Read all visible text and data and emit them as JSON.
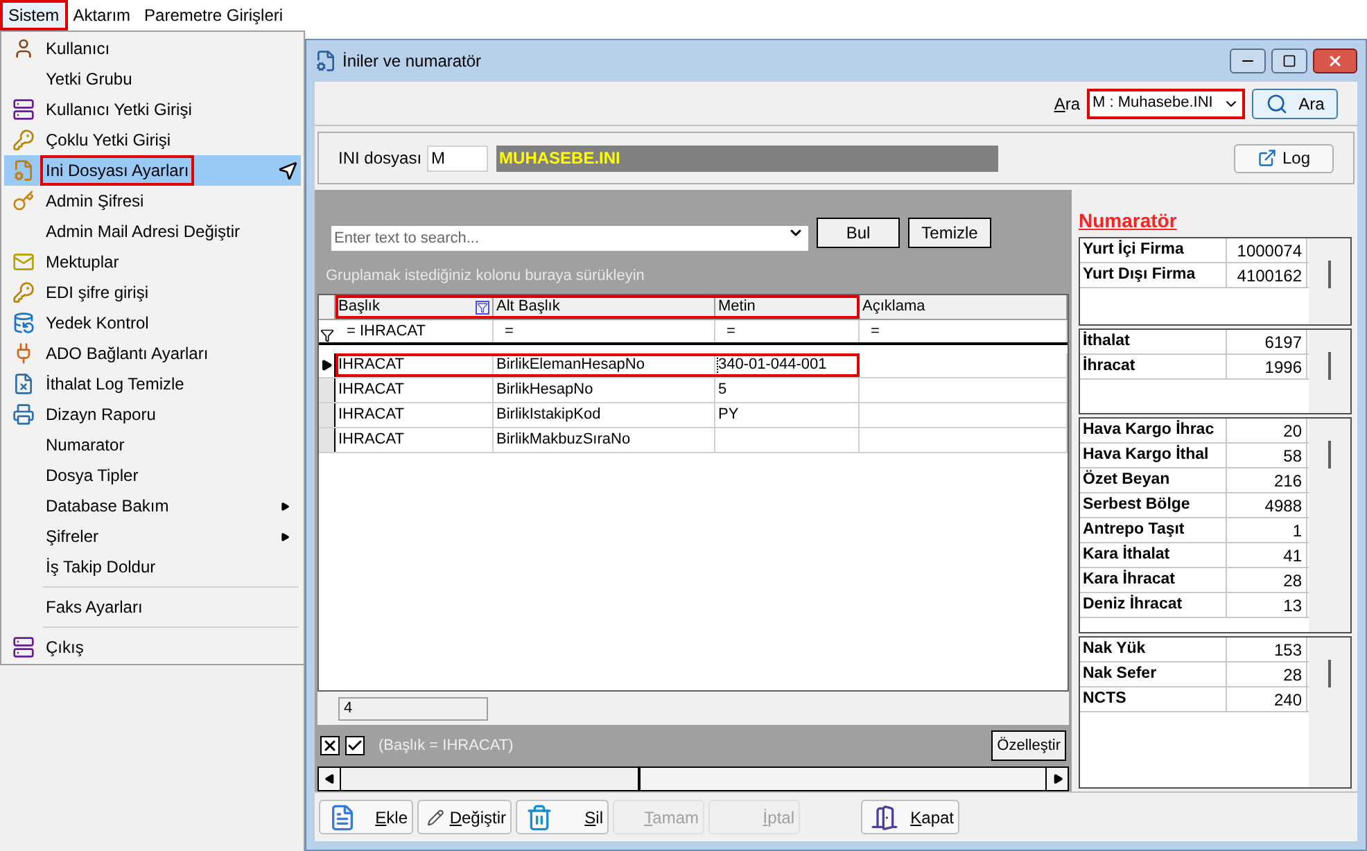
{
  "menubar": [
    {
      "label": "Sistem",
      "selected": true,
      "highlighted": true
    },
    {
      "label": "Aktarım",
      "selected": false,
      "highlighted": false
    },
    {
      "label": "Paremetre Girişleri",
      "selected": false,
      "highlighted": false
    }
  ],
  "menu": [
    {
      "kind": "item",
      "label": "Kullanıcı",
      "selected": false,
      "highlighted": false
    },
    {
      "kind": "item",
      "label": "Yetki Grubu",
      "selected": false,
      "highlighted": false
    },
    {
      "kind": "item",
      "label": "Kullanıcı Yetki Girişi",
      "selected": false,
      "highlighted": false
    },
    {
      "kind": "item",
      "label": "Çoklu Yetki Girişi",
      "selected": false,
      "highlighted": false
    },
    {
      "kind": "item",
      "label": "Ini Dosyası  Ayarları",
      "selected": true,
      "highlighted": true
    },
    {
      "kind": "item",
      "label": "Admin Şifresi",
      "selected": false,
      "highlighted": false
    },
    {
      "kind": "item",
      "label": "Admin Mail Adresi Değiştir",
      "selected": false,
      "highlighted": false
    },
    {
      "kind": "item",
      "label": "Mektuplar",
      "selected": false,
      "highlighted": false
    },
    {
      "kind": "item",
      "label": "EDI şifre girişi",
      "selected": false,
      "highlighted": false
    },
    {
      "kind": "item",
      "label": "Yedek Kontrol",
      "selected": false,
      "highlighted": false
    },
    {
      "kind": "item",
      "label": "ADO Bağlantı Ayarları",
      "selected": false,
      "highlighted": false
    },
    {
      "kind": "item",
      "label": "İthalat Log Temizle",
      "selected": false,
      "highlighted": false
    },
    {
      "kind": "item",
      "label": "Dizayn Raporu",
      "selected": false,
      "highlighted": false
    },
    {
      "kind": "item",
      "label": "Numarator",
      "selected": false,
      "highlighted": false
    },
    {
      "kind": "item",
      "label": "Dosya Tipler",
      "selected": false,
      "highlighted": false
    },
    {
      "kind": "submenu",
      "label": "Database Bakım",
      "selected": false,
      "highlighted": false
    },
    {
      "kind": "submenu",
      "label": "Şifreler",
      "selected": false,
      "highlighted": false
    },
    {
      "kind": "item",
      "label": "İş Takip Doldur",
      "selected": false,
      "highlighted": false
    },
    {
      "kind": "separator"
    },
    {
      "kind": "item",
      "label": "Faks Ayarları",
      "selected": false,
      "highlighted": false
    },
    {
      "kind": "separator"
    },
    {
      "kind": "item",
      "label": "Çıkış",
      "selected": false,
      "highlighted": false
    }
  ],
  "window": {
    "title": "İniler ve numaratör"
  },
  "toolbar": {
    "search_label": "Ara",
    "combo_value": "M : Muhasebe.INI",
    "combo_highlighted": true,
    "search_button": "Ara"
  },
  "ini": {
    "label": "INI dosyası",
    "code": "M",
    "file": "MUHASEBE.INI",
    "log_button": "Log"
  },
  "grid": {
    "search_placeholder": "Enter text to search...",
    "find_button": "Bul",
    "clear_button": "Temizle",
    "group_hint": "Gruplamak istediğiniz kolonu buraya sürükleyin",
    "columns": [
      {
        "label": "Başlık",
        "filtered": true
      },
      {
        "label": "Alt Başlık",
        "filtered": false
      },
      {
        "label": "Metin",
        "filtered": false
      },
      {
        "label": "Açıklama",
        "filtered": false
      }
    ],
    "header_highlighted": true,
    "filter_row": [
      "=  IHRACAT",
      "=",
      "=",
      "="
    ],
    "rows": [
      {
        "cells": [
          "IHRACAT",
          "BirlikElemanHesapNo",
          "340-01-044-001"
        ],
        "selected": true,
        "highlighted": true
      },
      {
        "cells": [
          "IHRACAT",
          "BirlikHesapNo",
          "5"
        ],
        "selected": false,
        "highlighted": false
      },
      {
        "cells": [
          "IHRACAT",
          "BirlikIstakipKod",
          "PY"
        ],
        "selected": false,
        "highlighted": false
      },
      {
        "cells": [
          "IHRACAT",
          "BirlikMakbuzSıraNo"
        ],
        "selected": false,
        "highlighted": false
      }
    ],
    "footer_count": "4",
    "filter": {
      "active": true,
      "text": "(Başlık = IHRACAT)"
    },
    "customize_button": "Özelleştir"
  },
  "numerator": {
    "title": "Numaratör",
    "groups": [
      {
        "rows": [
          {
            "label": "Yurt İçi Firma",
            "value": "1000074"
          },
          {
            "label": "Yurt Dışı Firma",
            "value": "4100162"
          }
        ]
      },
      {
        "rows": [
          {
            "label": "İthalat",
            "value": "6197"
          },
          {
            "label": "İhracat",
            "value": "1996"
          }
        ]
      },
      {
        "rows": [
          {
            "label": "Hava Kargo İhrac",
            "value": "20"
          },
          {
            "label": "Hava Kargo İthal",
            "value": "58"
          },
          {
            "label": "Özet Beyan",
            "value": "216"
          },
          {
            "label": "Serbest Bölge",
            "value": "4988"
          },
          {
            "label": "Antrepo Taşıt",
            "value": "1"
          },
          {
            "label": "Kara İthalat",
            "value": "41"
          },
          {
            "label": "Kara İhracat",
            "value": "28"
          },
          {
            "label": "Deniz İhracat",
            "value": "13"
          }
        ]
      },
      {
        "rows": [
          {
            "label": "Nak Yük",
            "value": "153"
          },
          {
            "label": "Nak Sefer",
            "value": "28"
          },
          {
            "label": "NCTS",
            "value": "240"
          }
        ]
      }
    ]
  },
  "buttons": [
    {
      "label": "Ekle",
      "disabled": false
    },
    {
      "label": "Değiştir",
      "disabled": false
    },
    {
      "label": "Sil",
      "disabled": false
    },
    {
      "label": "Tamam",
      "disabled": true
    },
    {
      "label": "İptal",
      "disabled": true
    },
    {
      "label": "Kapat",
      "disabled": false
    }
  ]
}
